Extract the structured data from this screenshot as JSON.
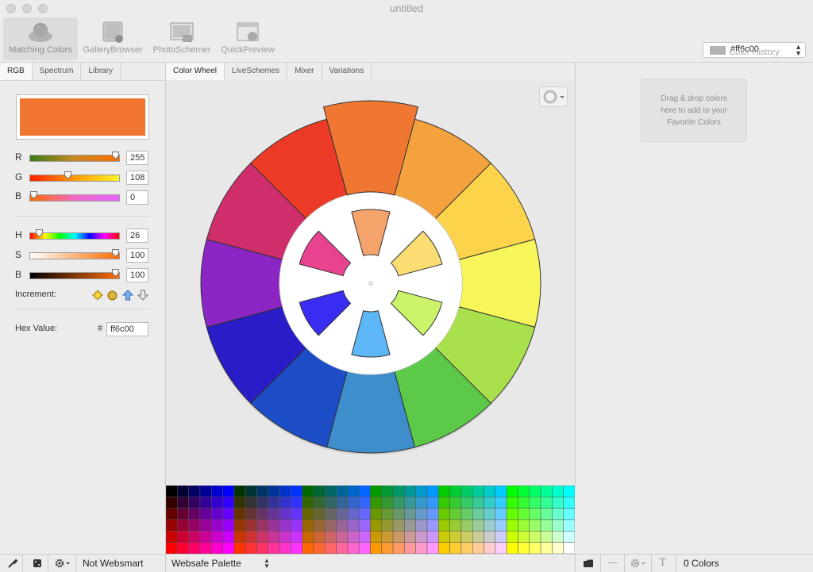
{
  "window": {
    "title": "untitled"
  },
  "toolbar": {
    "tools": [
      {
        "label": "Matching Colors",
        "icon": "matching-colors-icon",
        "active": true
      },
      {
        "label": "GalleryBrowser",
        "icon": "gallery-browser-icon",
        "active": false
      },
      {
        "label": "PhotoSchemer",
        "icon": "photo-schemer-icon",
        "active": false
      },
      {
        "label": "QuickPreview",
        "icon": "quick-preview-icon",
        "active": false
      }
    ],
    "color_history": {
      "value": "#ff6c00",
      "label": "Color History",
      "swatch": "#b3b3b3"
    }
  },
  "left_panel": {
    "tabs": [
      "RGB",
      "Spectrum",
      "Library"
    ],
    "current_color": "#ef7530",
    "rgb": [
      {
        "label": "R",
        "value": "255",
        "fraction": 1.0
      },
      {
        "label": "G",
        "value": "108",
        "fraction": 0.42
      },
      {
        "label": "B",
        "value": "0",
        "fraction": 0.0
      }
    ],
    "hsb": [
      {
        "label": "H",
        "value": "26",
        "fraction": 0.07
      },
      {
        "label": "S",
        "value": "100",
        "fraction": 1.0
      },
      {
        "label": "B",
        "value": "100",
        "fraction": 1.0
      }
    ],
    "increment_label": "Increment:",
    "increment_icons": [
      "sun-icon",
      "dot-icon",
      "arrow-up-icon",
      "arrow-down-icon"
    ],
    "hex_label": "Hex Value:",
    "hex_prefix": "#",
    "hex_value": "ff6c00"
  },
  "center": {
    "tabs": [
      "Color Wheel",
      "LiveSchemes",
      "Mixer",
      "Variations"
    ],
    "wheel_colors": [
      "#ef7732",
      "#f4a23d",
      "#fbd44c",
      "#f6f55a",
      "#a9e04b",
      "#5cc948",
      "#3d8ecb",
      "#1d4dc6",
      "#2a1cc6",
      "#8b26c5",
      "#d02d6c",
      "#ec3a26"
    ],
    "inner_colors": [
      "#f4a46a",
      "#fbdd73",
      "#cbf46b",
      "#5db7f7",
      "#3b2cf4",
      "#e94390"
    ]
  },
  "right_panel": {
    "favorites_text": [
      "Drag & drop colors",
      "here to add to your",
      "Favorite Colors"
    ]
  },
  "bottom_bar": {
    "websmart": "Not Websmart",
    "palette": "Websafe Palette",
    "count": "0 Colors"
  }
}
